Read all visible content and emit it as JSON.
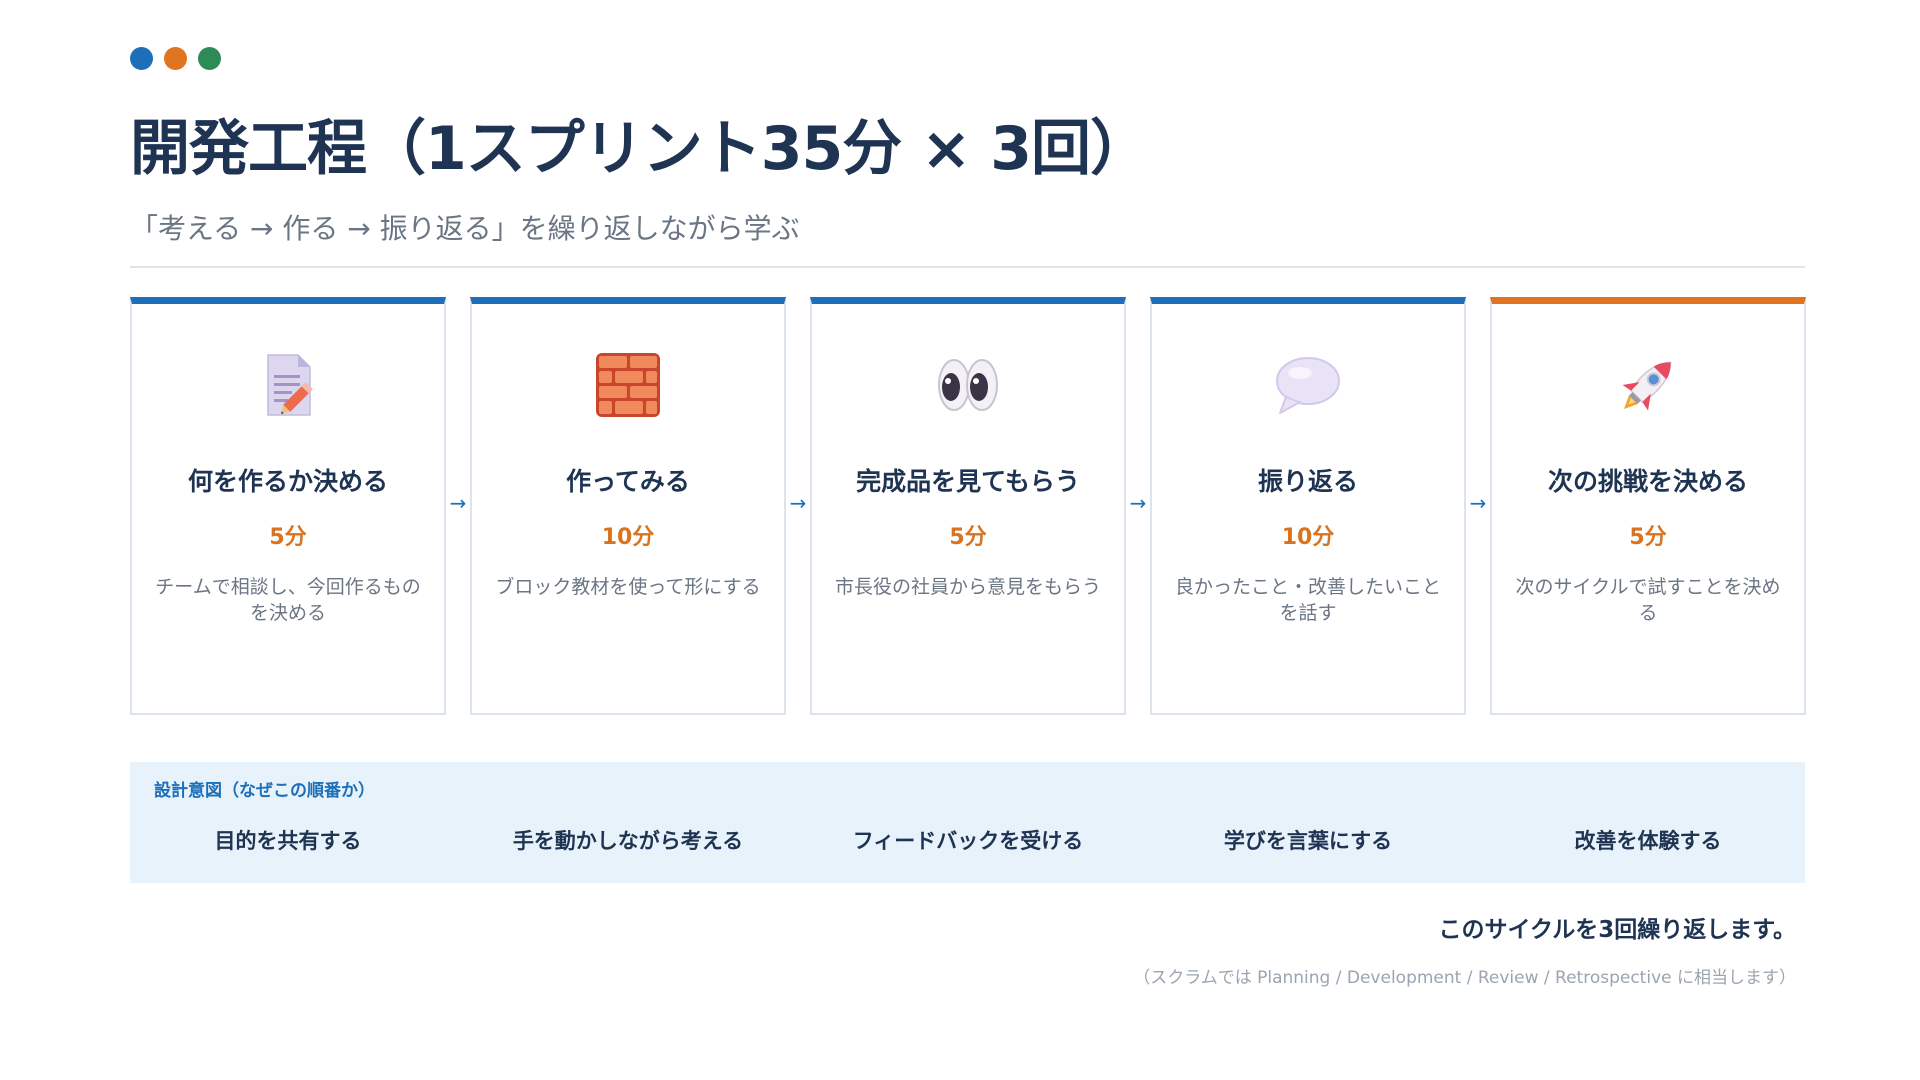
{
  "colors": {
    "dot_blue": "#1c6fb8",
    "dot_orange": "#e07420",
    "dot_green": "#2e8b57",
    "accent_blue": "#1c6fb8",
    "accent_orange": "#e07420",
    "title_navy": "#1f3452",
    "intent_bg": "#e8f2fb"
  },
  "header": {
    "title": "開発工程（1スプリント35分 × 3回）",
    "subtitle": "「考える → 作る → 振り返る」を繰り返しながら学ぶ"
  },
  "steps": [
    {
      "icon": "memo-pencil-icon",
      "title": "何を作るか決める",
      "duration": "5分",
      "description": "チームで相談し、今回作るものを決める"
    },
    {
      "icon": "brick-icon",
      "title": "作ってみる",
      "duration": "10分",
      "description": "ブロック教材を使って形にする"
    },
    {
      "icon": "eyes-icon",
      "title": "完成品を見てもらう",
      "duration": "5分",
      "description": "市長役の社員から意見をもらう"
    },
    {
      "icon": "speech-bubble-icon",
      "title": "振り返る",
      "duration": "10分",
      "description": "良かったこと・改善したいことを話す"
    },
    {
      "icon": "rocket-icon",
      "title": "次の挑戦を決める",
      "duration": "5分",
      "description": "次のサイクルで試すことを決める"
    }
  ],
  "arrow_glyph": "→",
  "design_intent": {
    "label": "設計意図（なぜこの順番か）",
    "items": [
      "目的を共有する",
      "手を動かしながら考える",
      "フィードバックを受ける",
      "学びを言葉にする",
      "改善を体験する"
    ]
  },
  "footer": {
    "repeat_text": "このサイクルを3回繰り返します。",
    "note": "（スクラムでは Planning / Development / Review / Retrospective に相当します）"
  }
}
